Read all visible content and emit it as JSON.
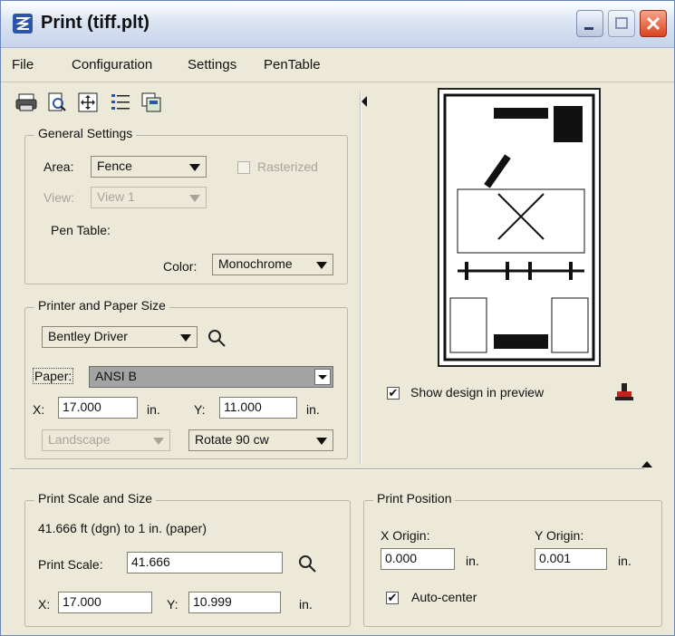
{
  "window": {
    "title": "Print  (tiff.plt)"
  },
  "menu": {
    "file": "File",
    "configuration": "Configuration",
    "settings": "Settings",
    "pentable": "PenTable"
  },
  "general_settings": {
    "legend": "General Settings",
    "area_label": "Area:",
    "area_value": "Fence",
    "rasterized_label": "Rasterized",
    "view_label": "View:",
    "view_value": "View 1",
    "pen_table_label": "Pen Table:",
    "color_label": "Color:",
    "color_value": "Monochrome"
  },
  "printer": {
    "legend": "Printer and Paper Size",
    "driver_value": "Bentley Driver",
    "paper_label": "Paper:",
    "paper_value": "ANSI B",
    "x_label": "X:",
    "x_value": "17.000",
    "y_label": "Y:",
    "y_value": "11.000",
    "unit": "in.",
    "orientation_value": "Landscape",
    "rotate_value": "Rotate 90 cw"
  },
  "preview": {
    "show_design_label": "Show design in preview",
    "show_design_checked": true
  },
  "scale": {
    "legend": "Print Scale and Size",
    "ratio_text": "41.666 ft (dgn) to 1 in. (paper)",
    "print_scale_label": "Print Scale:",
    "print_scale_value": "41.666",
    "x_label": "X:",
    "x_value": "17.000",
    "y_label": "Y:",
    "y_value": "10.999",
    "unit": "in."
  },
  "position": {
    "legend": "Print Position",
    "x_origin_label": "X Origin:",
    "x_origin_value": "0.000",
    "y_origin_label": "Y Origin:",
    "y_origin_value": "0.001",
    "unit": "in.",
    "auto_center_label": "Auto-center",
    "auto_center_checked": true
  },
  "colors": {
    "window_bg": "#ece9d8",
    "titlebar_start": "#ffffff",
    "titlebar_end": "#c6d3ea",
    "close_button": "#d8431d"
  }
}
